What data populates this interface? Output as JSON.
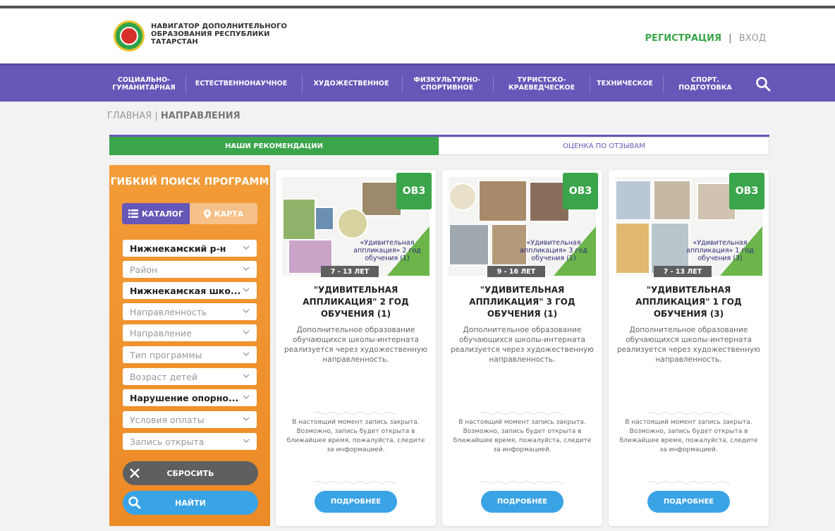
{
  "header": {
    "logo_text": "НАВИГАТОР ДОПОЛНИТЕЛЬНОГО ОБРАЗОВАНИЯ РЕСПУБЛИКИ ТАТАРСТАН",
    "register": "РЕГИСТРАЦИЯ",
    "separator": "|",
    "login": "ВХОД"
  },
  "nav": {
    "items": [
      {
        "label": "СОЦИАЛЬНО-\nГУМАНИТАРНАЯ"
      },
      {
        "label": "ЕСТЕСТВЕННОНАУЧНОЕ"
      },
      {
        "label": "ХУДОЖЕСТВЕННОЕ"
      },
      {
        "label": "ФИЗКУЛЬТУРНО-\nСПОРТИВНОЕ"
      },
      {
        "label": "ТУРИСТСКО-\nКРАЕВЕДЧЕСКОЕ"
      },
      {
        "label": "ТЕХНИЧЕСКОЕ"
      },
      {
        "label": "СПОРТ.\nПОДГОТОВКА"
      }
    ],
    "search_icon": "search-icon"
  },
  "breadcrumb": {
    "home": "ГЛАВНАЯ",
    "separator": "|",
    "current": "НАПРАВЛЕНИЯ"
  },
  "tabs": {
    "recommendations": "НАШИ РЕКОМЕНДАЦИИ",
    "reviews": "ОЦЕНКА ПО ОТЗЫВАМ"
  },
  "sidebar": {
    "title": "ГИБКИЙ ПОИСК ПРОГРАММ",
    "catalog": "КАТАЛОГ",
    "map": "КАРТА",
    "filters": [
      {
        "text": "Нижнекамский р-н",
        "filled": true
      },
      {
        "text": "Район",
        "filled": false
      },
      {
        "text": "Нижнекамская шко...",
        "filled": true
      },
      {
        "text": "Направленность",
        "filled": false
      },
      {
        "text": "Направление",
        "filled": false
      },
      {
        "text": "Тип программы",
        "filled": false
      },
      {
        "text": "Возраст детей",
        "filled": false
      },
      {
        "text": "Нарушение опорно...",
        "filled": true
      },
      {
        "text": "Условия оплаты",
        "filled": false
      },
      {
        "text": "Запись открыта",
        "filled": false
      }
    ],
    "reset": "СБРОСИТЬ",
    "find": "НАЙТИ"
  },
  "cards": [
    {
      "badge": "ОВЗ",
      "image_caption": "«Удивительная аппликация» 2 год обучения (1)",
      "age": "7 - 13 ЛЕТ",
      "title": "\"УДИВИТЕЛЬНАЯ АППЛИКАЦИЯ\" 2 ГОД ОБУЧЕНИЯ (1)",
      "description": "Дополнительное образование обучающихся школы-интерната реализуется через художественную направленность.",
      "note": "В настоящий момент запись закрыта. Возможно, запись будет открыта в ближайшее время, пожалуйста, следите за информацией.",
      "button": "ПОДРОБНЕЕ"
    },
    {
      "badge": "ОВЗ",
      "image_caption": "«Удивительная аппликация» 3 год обучения (1)",
      "age": "9 - 16 ЛЕТ",
      "title": "\"УДИВИТЕЛЬНАЯ АППЛИКАЦИЯ\" 3 ГОД ОБУЧЕНИЯ (1)",
      "description": "Дополнительное образование обучающихся школы-интерната реализуется через художественную направленность.",
      "note": "В настоящий момент запись закрыта. Возможно, запись будет открыта в ближайшее время, пожалуйста, следите за информацией.",
      "button": "ПОДРОБНЕЕ"
    },
    {
      "badge": "ОВЗ",
      "image_caption": "«Удивительная аппликация» 1 год обучения (3)",
      "age": "7 - 13 ЛЕТ",
      "title": "\"УДИВИТЕЛЬНАЯ АППЛИКАЦИЯ\" 1 ГОД ОБУЧЕНИЯ (3)",
      "description": "Дополнительное образование обучающихся школы-интерната реализуется через художественную направленность.",
      "note": "В настоящий момент запись закрыта. Возможно, запись будет открыта в ближайшее время, пожалуйста, следите за информацией.",
      "button": "ПОДРОБНЕЕ"
    }
  ],
  "colors": {
    "purple": "#6558b8",
    "green": "#3aa54a",
    "orange": "#f29c38",
    "blue": "#3aa3e6",
    "gray": "#5f5f5f"
  }
}
